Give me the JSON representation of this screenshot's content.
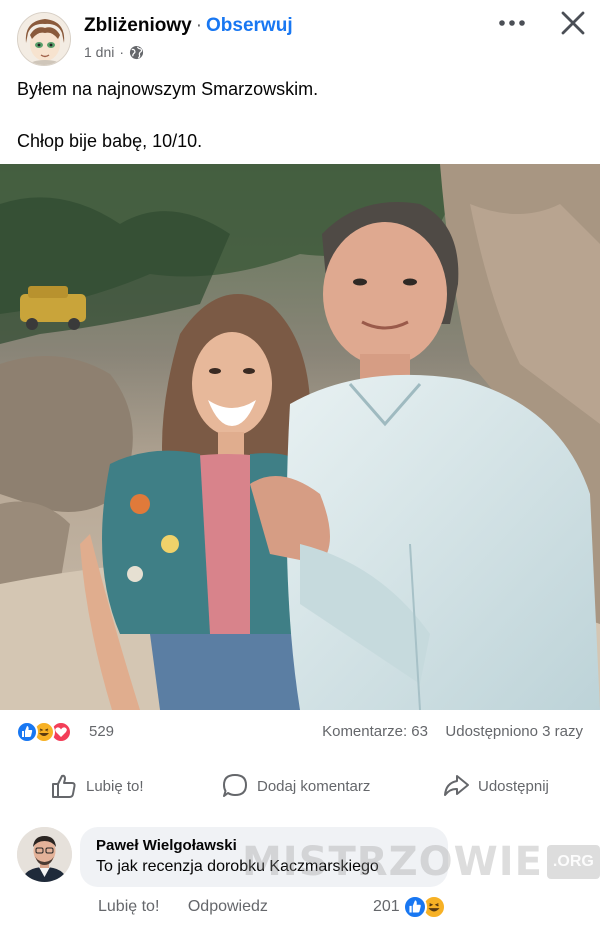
{
  "post": {
    "author": "Zbliżeniowy",
    "separator": "·",
    "follow_label": "Obserwuj",
    "time": "1 dni",
    "time_separator": "·",
    "audience_icon": "globe-icon",
    "text_lines": [
      "Byłem na najnowszym Smarzowskim.",
      "Chłop bije babę, 10/10."
    ],
    "menu_icon": "more-horizontal-icon",
    "close_icon": "close-icon"
  },
  "stats": {
    "reactions": [
      "like",
      "haha",
      "love"
    ],
    "reaction_count": "529",
    "comments": "Komentarze: 63",
    "shares": "Udostępniono 3 razy"
  },
  "actions": {
    "like_label": "Lubię to!",
    "comment_label": "Dodaj komentarz",
    "share_label": "Udostępnij"
  },
  "comment": {
    "author": "Paweł Wielgoławski",
    "text": "To jak recenzja dorobku Kaczmarskiego",
    "like_label": "Lubię to!",
    "reply_label": "Odpowiedz",
    "reaction_count": "201",
    "reactions": [
      "like",
      "haha"
    ]
  },
  "watermark": {
    "text": "MISTRZOWIE",
    "badge": ".ORG"
  },
  "colors": {
    "accent": "#1877f2",
    "secondary_text": "#65676b",
    "love": "#f33e58",
    "haha": "#f7b125",
    "bubble": "#f0f2f5"
  }
}
